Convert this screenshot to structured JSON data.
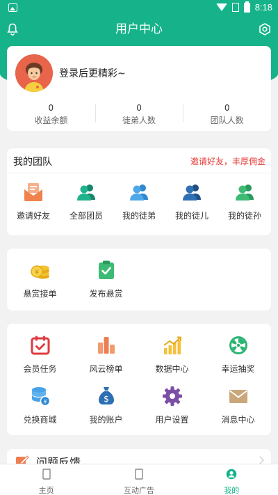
{
  "status_bar": {
    "time": "8:18"
  },
  "header": {
    "title": "用户中心"
  },
  "profile": {
    "login_prompt": "登录后更精彩~",
    "stats": [
      {
        "value": "0",
        "label": "收益余额"
      },
      {
        "value": "0",
        "label": "徒弟人数"
      },
      {
        "value": "0",
        "label": "团队人数"
      }
    ]
  },
  "team": {
    "title": "我的团队",
    "promo": "邀请好友，丰厚佣金",
    "items": [
      {
        "label": "邀请好友",
        "icon": "envelope-icon",
        "color": "#f0824e"
      },
      {
        "label": "全部团员",
        "icon": "team-icon",
        "color": "#1fb28d"
      },
      {
        "label": "我的徒弟",
        "icon": "users-icon",
        "color": "#4ea8e8"
      },
      {
        "label": "我的徒儿",
        "icon": "users-icon",
        "color": "#2f6fb3"
      },
      {
        "label": "我的徒孙",
        "icon": "users-icon",
        "color": "#3dbb74"
      }
    ]
  },
  "bounty": {
    "items": [
      {
        "label": "悬赏接单",
        "icon": "coins-icon",
        "color": "#f2c230"
      },
      {
        "label": "发布悬赏",
        "icon": "clipboard-check-icon",
        "color": "#3dbb74"
      }
    ]
  },
  "menu": {
    "items": [
      {
        "label": "会员任务",
        "icon": "calendar-check-icon",
        "color": "#e0393e"
      },
      {
        "label": "风云榜单",
        "icon": "ranking-icon",
        "color": "#ee7e52"
      },
      {
        "label": "数据中心",
        "icon": "bar-chart-icon",
        "color": "#f5c13c"
      },
      {
        "label": "幸运抽奖",
        "icon": "lucky-wheel-icon",
        "color": "#2cb573"
      },
      {
        "label": "兑换商城",
        "icon": "database-icon",
        "color": "#4aa3e8"
      },
      {
        "label": "我的账户",
        "icon": "money-bag-icon",
        "color": "#2d6fb4"
      },
      {
        "label": "用户设置",
        "icon": "gear-icon",
        "color": "#7b4fa6"
      },
      {
        "label": "消息中心",
        "icon": "mail-icon",
        "color": "#c9a77a"
      }
    ]
  },
  "feedback": {
    "label": "问题反馈"
  },
  "tabbar": {
    "items": [
      {
        "label": "主页",
        "icon": "home-icon"
      },
      {
        "label": "互动广告",
        "icon": "ad-icon"
      },
      {
        "label": "我的",
        "icon": "profile-icon"
      }
    ],
    "active_color": "#16b38a"
  },
  "colors": {
    "brand": "#16b38a",
    "promo": "#e53935"
  }
}
